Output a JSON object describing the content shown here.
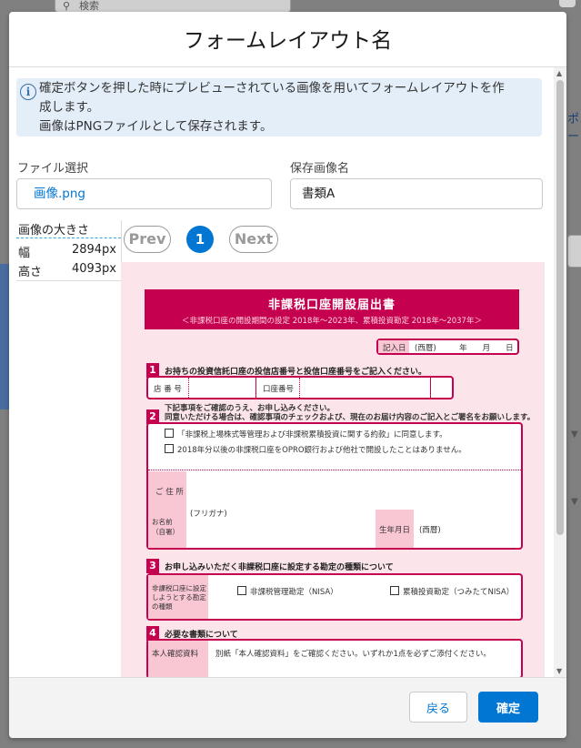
{
  "background": {
    "search_placeholder": "検索",
    "right_text": "ポー"
  },
  "modal": {
    "title": "フォームレイアウト名",
    "info_line1": "確定ボタンを押した時にプレビューされている画像を用いてフォームレイアウトを作",
    "info_line2": "成します。",
    "info_line3": "画像はPNGファイルとして保存されます。",
    "file_label": "ファイル選択",
    "file_value": "画像.png",
    "name_label": "保存画像名",
    "name_value": "書類A",
    "size": {
      "title": "画像の大きさ",
      "width_label": "幅",
      "width_value": "2894px",
      "height_label": "高さ",
      "height_value": "4093px"
    },
    "pager": {
      "prev": "Prev",
      "current": "1",
      "next": "Next"
    },
    "footer": {
      "back": "戻る",
      "confirm": "確定"
    }
  },
  "document": {
    "title": "非課税口座開設届出書",
    "subtitle": "＜非課税口座の開設期間の設定 2018年～2023年、累積投資勘定 2018年～2037年＞",
    "date_label": "記入日",
    "date_text": "(西暦)　　　年　　月　　日",
    "sec1_head": "お持ちの投資信託口座の投信店番号と投信口座番号をご記入ください。",
    "sec1_store": "店 番 号",
    "sec1_account": "口座番号",
    "sec2_intro1": "下記事項をご確認のうえ、お申し込みください。",
    "sec2_intro2": "同意いただける場合は、確認事項のチェックおよび、現在のお届け内容のご記入とご署名をお願いします。",
    "sec2_check1": "「非課税上場株式等管理および非課税累積投資に関する約款」に同意します。",
    "sec2_check2": "2018年分以後の非課税口座をOPRO銀行および他社で開設したことはありません。",
    "sec2_address": "ご 住 所",
    "sec2_furigana": "(フリガナ)",
    "sec2_name": "お名前（自署）",
    "sec2_birth": "生年月日",
    "sec2_birth_text": "(西暦)",
    "sec3_num": "3",
    "sec3_head": "お申し込みいただく非課税口座に設定する勘定の種類について",
    "sec3_label": "非課税口座に設定しようとする勘定の種類",
    "sec3_opt1": "非課税管理勘定（NISA）",
    "sec3_opt2": "累積投資勘定（つみたてNISA）",
    "sec4_num": "4",
    "sec4_head": "必要な書類について",
    "sec4_label": "本人確認資料",
    "sec4_text": "別紙「本人確認資料」をご確認ください。いずれか1点を必ずご添付ください。"
  }
}
